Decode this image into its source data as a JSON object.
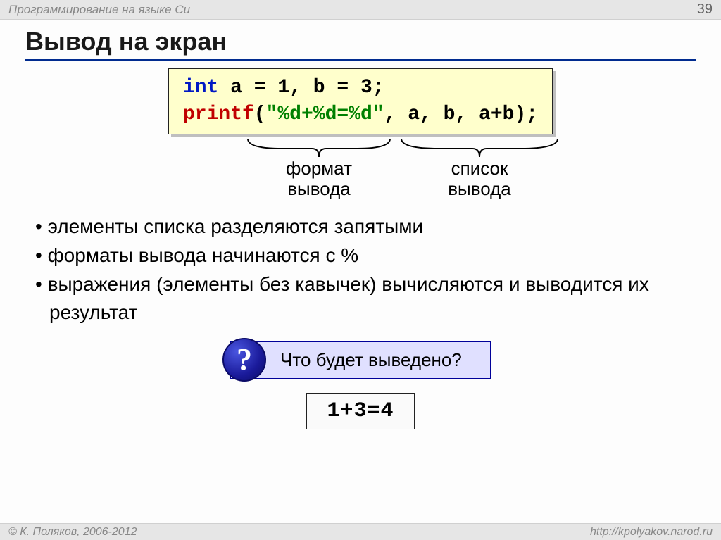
{
  "topbar": {
    "subject": "Программирование на языке Си",
    "page": "39"
  },
  "title": "Вывод на экран",
  "code": {
    "line1": {
      "kw": "int",
      "rest": " a = 1, b = 3;"
    },
    "line2": {
      "func": "printf",
      "lparen": "(",
      "str": "\"%d+%d=%d\"",
      "args": ", a, b, a+b);"
    }
  },
  "brackets": {
    "left": {
      "l1": "формат",
      "l2": "вывода"
    },
    "right": {
      "l1": "список",
      "l2": "вывода"
    }
  },
  "bullets": [
    "элементы списка разделяются запятыми",
    "форматы вывода начинаются с %",
    "выражения (элементы без кавычек) вычисляются и выводится их результат"
  ],
  "question": {
    "mark": "?",
    "text": "Что будет выведено?"
  },
  "answer": "1+3=4",
  "footer": {
    "copyright": "© К. Поляков, 2006-2012",
    "url": "http://kpolyakov.narod.ru"
  }
}
